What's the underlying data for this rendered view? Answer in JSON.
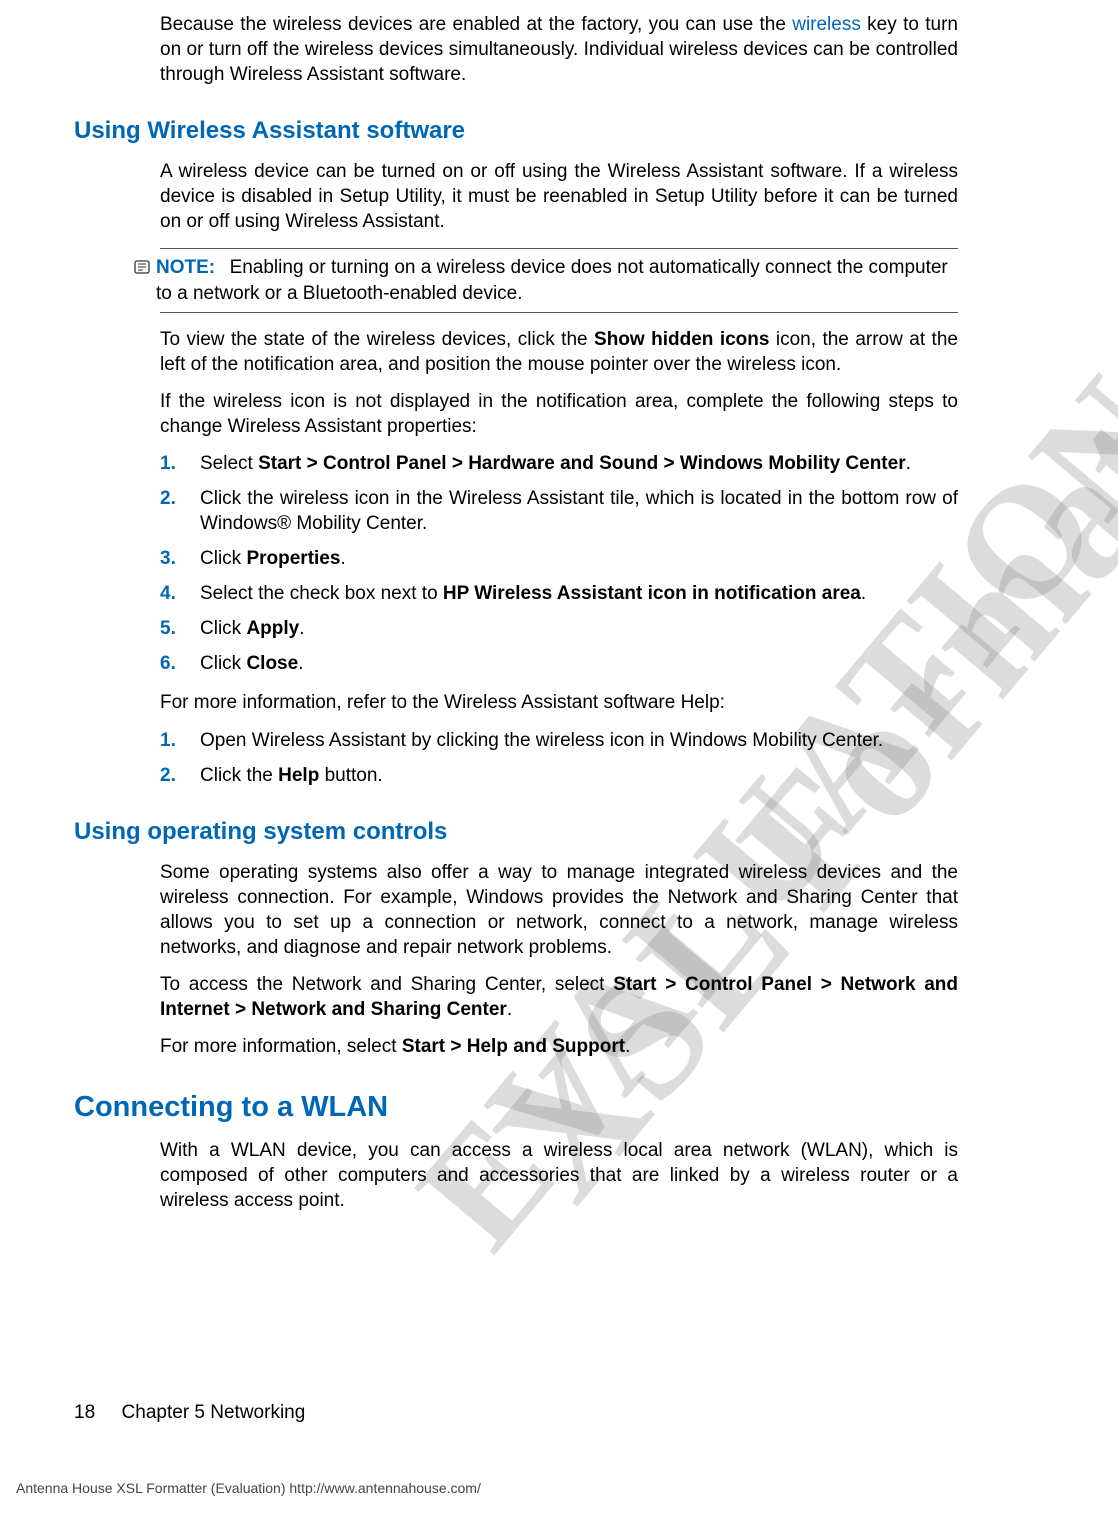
{
  "intro": {
    "p1_a": "Because the wireless devices are enabled at the factory, you can use the ",
    "p1_link": "wireless",
    "p1_b": " key to turn on or turn off the wireless devices simultaneously. Individual wireless devices can be controlled through Wireless Assistant software."
  },
  "sec_was": {
    "heading": "Using Wireless Assistant software",
    "p1": "A wireless device can be turned on or off using the Wireless Assistant software. If a wireless device is disabled in Setup Utility, it must be reenabled in Setup Utility before it can be turned on or off using Wireless Assistant.",
    "note_label": "NOTE:",
    "note_text": "Enabling or turning on a wireless device does not automatically connect the computer to a network or a Bluetooth-enabled device.",
    "p2_a": "To view the state of the wireless devices, click the ",
    "p2_b": "Show hidden icons",
    "p2_c": " icon, the arrow at the left of the notification area, and position the mouse pointer over the wireless icon.",
    "p3": "If the wireless icon is not displayed in the notification area, complete the following steps to change Wireless Assistant properties:",
    "steps1": [
      {
        "n": "1.",
        "a": "Select ",
        "b": "Start > Control Panel > Hardware and Sound > Windows Mobility Center",
        "c": "."
      },
      {
        "n": "2.",
        "a": "Click the wireless icon in the Wireless Assistant tile, which is located in the bottom row of Windows® Mobility Center.",
        "b": "",
        "c": ""
      },
      {
        "n": "3.",
        "a": "Click ",
        "b": "Properties",
        "c": "."
      },
      {
        "n": "4.",
        "a": "Select the check box next to ",
        "b": "HP Wireless Assistant icon in notification area",
        "c": "."
      },
      {
        "n": "5.",
        "a": "Click ",
        "b": "Apply",
        "c": "."
      },
      {
        "n": "6.",
        "a": "Click ",
        "b": "Close",
        "c": "."
      }
    ],
    "p4": "For more information, refer to the Wireless Assistant software Help:",
    "steps2": [
      {
        "n": "1.",
        "a": "Open Wireless Assistant by clicking the wireless icon in Windows Mobility Center.",
        "b": "",
        "c": ""
      },
      {
        "n": "2.",
        "a": "Click the ",
        "b": "Help",
        "c": " button."
      }
    ]
  },
  "sec_os": {
    "heading": "Using operating system controls",
    "p1": "Some operating systems also offer a way to manage integrated wireless devices and the wireless connection. For example, Windows provides the Network and Sharing Center that allows you to set up a connection or network, connect to a network, manage wireless networks, and diagnose and repair network problems.",
    "p2_a": "To access the Network and Sharing Center, select ",
    "p2_b": "Start > Control Panel > Network and Internet > Network and Sharing Center",
    "p2_c": ".",
    "p3_a": "For more information, select ",
    "p3_b": "Start > Help and Support",
    "p3_c": "."
  },
  "sec_wlan": {
    "heading": "Connecting to a WLAN",
    "p1": "With a WLAN device, you can access a wireless local area network (WLAN), which is composed of other computers and accessories that are linked by a wireless router or a wireless access point."
  },
  "footer": {
    "pagenum": "18",
    "chapter": "Chapter 5   Networking"
  },
  "antenna": "Antenna House XSL Formatter (Evaluation)  http://www.antennahouse.com/",
  "watermarks": {
    "w1": "XSL Formatter",
    "w2": "EVALUATION"
  }
}
